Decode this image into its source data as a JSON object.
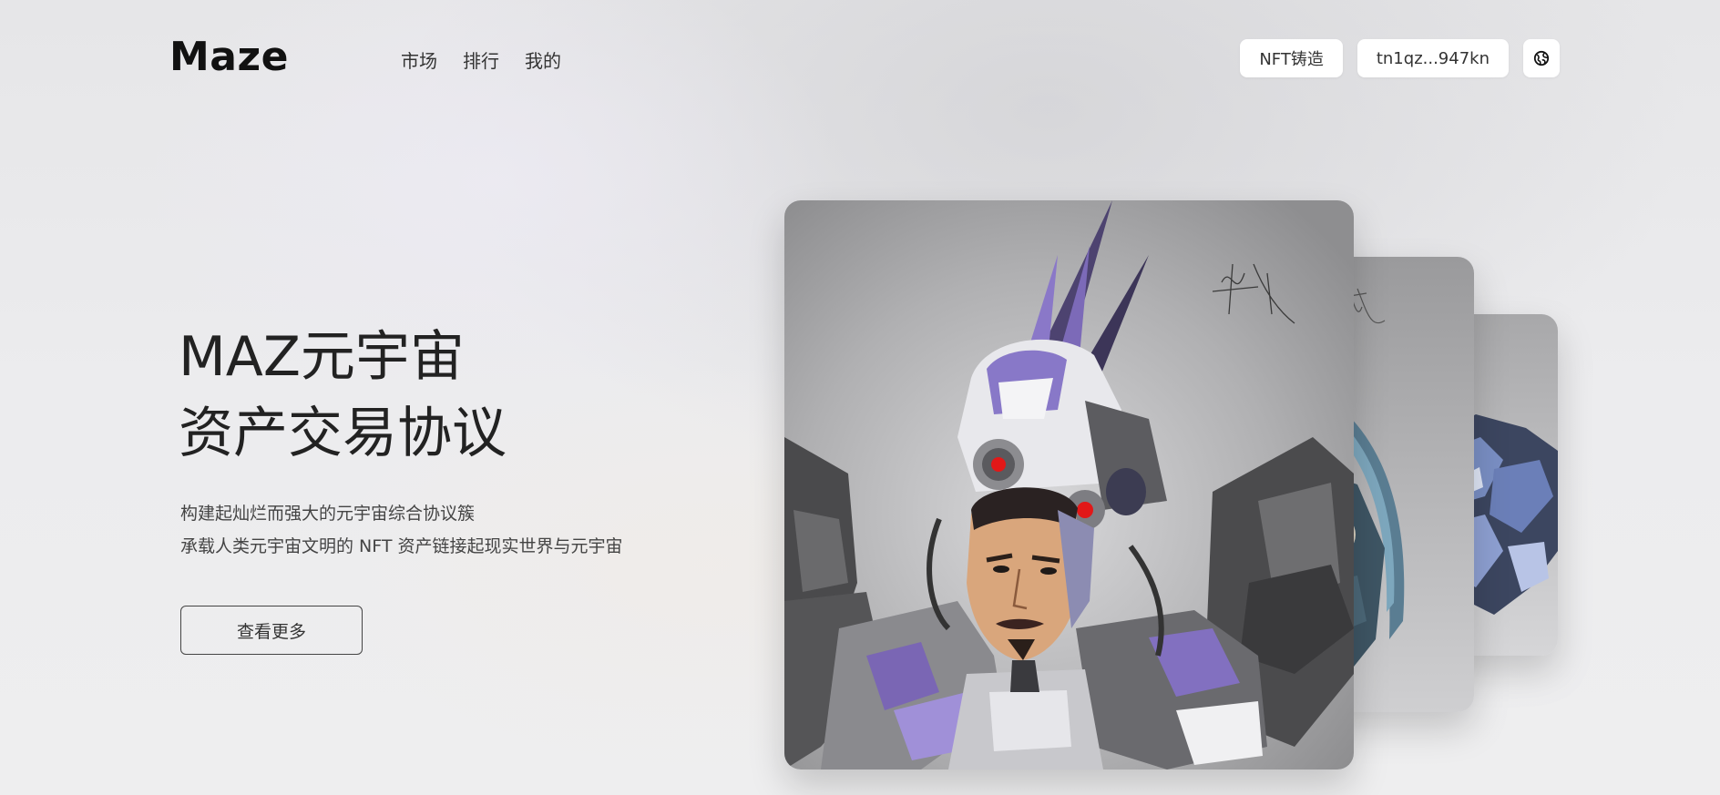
{
  "header": {
    "logo": "Maze",
    "nav": [
      {
        "label": "市场"
      },
      {
        "label": "排行"
      },
      {
        "label": "我的"
      }
    ],
    "mint_button": "NFT铸造",
    "wallet_address": "tn1qz...947kn",
    "language_icon": "globe-icon"
  },
  "hero": {
    "title_line1": "MAZ元宇宙",
    "title_line2": "资产交易协议",
    "subtitle_line1": "构建起灿烂而强大的元宇宙综合协议簇",
    "subtitle_line2": "承载人类元宇宙文明的 NFT 资产链接起现实世界与元宇宙",
    "more_button": "查看更多"
  },
  "nft_cards": [
    {
      "name": "mecha-character-front",
      "signature": "村叔"
    },
    {
      "name": "skull-mecha-middle",
      "signature": "郭嘉"
    },
    {
      "name": "blue-mecha-back"
    }
  ],
  "colors": {
    "background": "#eaeaec",
    "text_primary": "#222222",
    "accent_purple": "#7b68b0",
    "button_bg": "#ffffff"
  }
}
